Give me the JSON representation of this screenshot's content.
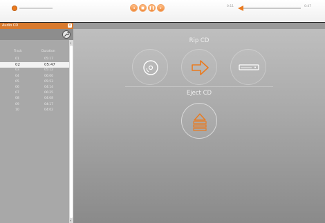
{
  "transport": {
    "time_elapsed": "0:11",
    "time_total": "0:47",
    "seek_fraction": 0.0,
    "buttons": [
      {
        "name": "previous",
        "glyph": "◂"
      },
      {
        "name": "stop",
        "glyph": "■"
      },
      {
        "name": "pause",
        "glyph": "❚❚"
      },
      {
        "name": "next",
        "glyph": "▸"
      }
    ],
    "accent_color": "#ea7a1e"
  },
  "sidebar": {
    "source_label": "Audio CD",
    "close_glyph": "×",
    "settings_icon": "wrench-icon",
    "columns": {
      "track": "Track",
      "duration": "Duration"
    },
    "tracks": [
      {
        "track": "01",
        "duration": "05:17"
      },
      {
        "track": "02",
        "duration": "05:47",
        "selected": true
      },
      {
        "track": "03",
        "duration": "05:12"
      },
      {
        "track": "04",
        "duration": "06:00"
      },
      {
        "track": "05",
        "duration": "05:53"
      },
      {
        "track": "06",
        "duration": "04:14"
      },
      {
        "track": "07",
        "duration": "06:25"
      },
      {
        "track": "08",
        "duration": "04:08"
      },
      {
        "track": "09",
        "duration": "04:17"
      },
      {
        "track": "10",
        "duration": "04:02"
      }
    ]
  },
  "main": {
    "rip_title": "Rip CD",
    "eject_title": "Eject CD",
    "icons": [
      "cd-disc-icon",
      "arrow-right-icon",
      "drive-icon",
      "eject-stack-icon"
    ]
  }
}
